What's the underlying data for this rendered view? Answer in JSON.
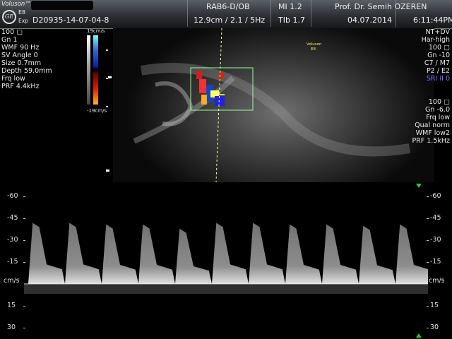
{
  "header": {
    "brand": "Voluson™",
    "model": "E8",
    "model_sub": "Exp",
    "logo_text": "GE",
    "patient_id": "D20935-14-07-04-8",
    "probe": "RAB6-D/OB",
    "mi": "MI  1.2",
    "scan_params": "12.9cm / 2.1 /  5Hz",
    "tib": "TIb  1.7",
    "operator": "Prof. Dr. Semih OZEREN",
    "date": "04.07.2014",
    "time": "6:11:44PM"
  },
  "left_panel": {
    "params": [
      "100",
      "Gn  1",
      "WMF 90 Hz",
      "SV Angle  0",
      "Size  0.7mm",
      "Depth 59.0mm",
      "Frq low",
      "PRF  4.4kHz"
    ]
  },
  "color_bar": {
    "top_label": "19cm/s",
    "bottom_label": "-19cm/s"
  },
  "image": {
    "watermark_line1": "Voluson",
    "watermark_line2": "E8"
  },
  "right_panel": {
    "bmode": [
      "NT+DV",
      "Har-high",
      "100",
      "Gn -10",
      "C7 / M7",
      "P2 / E2"
    ],
    "sri": "SRI II 0",
    "doppler": [
      "100",
      "Gn -6.0",
      "Frq low",
      "Qual norm",
      "WMF low2",
      "PRF  1.5kHz"
    ]
  },
  "spectral": {
    "unit": "cm/s",
    "ticks": [
      "-60",
      "-45",
      "-30",
      "-15",
      "15",
      "30"
    ],
    "tick_values": [
      -60,
      -45,
      -30,
      -15,
      15,
      30
    ],
    "range": [
      -68,
      34
    ],
    "peak_velocities": [
      -42,
      -42,
      -41,
      -41,
      -38,
      -42,
      -42,
      -41,
      -41,
      -40,
      -41
    ],
    "baseline": 0
  }
}
